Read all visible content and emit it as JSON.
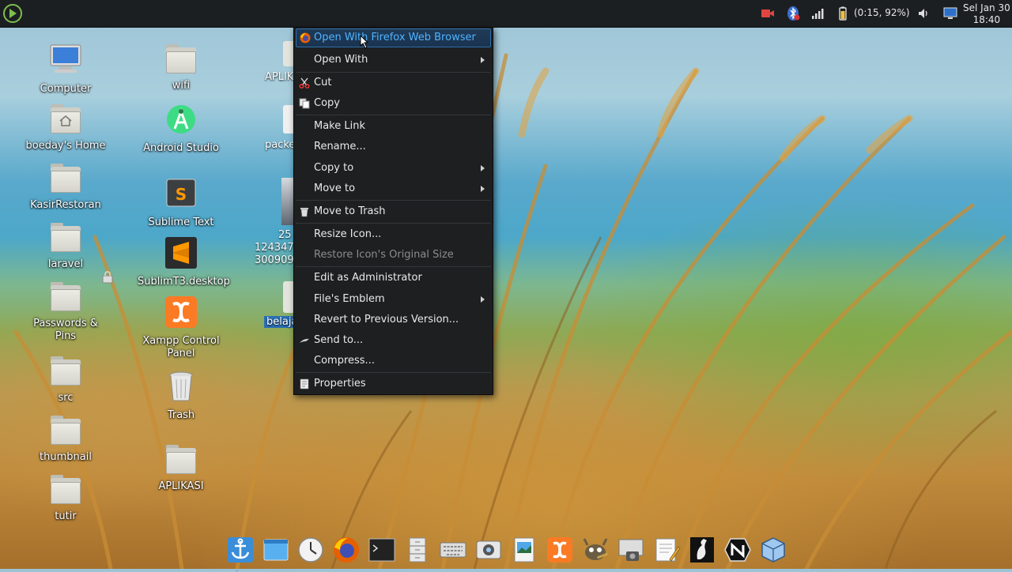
{
  "top_panel": {
    "battery_status": "(0:15, 92%)",
    "clock_line1": "Sel Jan 30",
    "clock_line2": "18:40",
    "icons": [
      "menu-icon",
      "camera-record-icon",
      "bluetooth-icon",
      "signal-icon",
      "battery-charging-icon",
      "volume-icon",
      "display-icon"
    ]
  },
  "desktop": {
    "col1": [
      "Computer",
      "boeday's Home",
      "KasirRestoran",
      "laravel",
      "Passwords & Pins",
      "src",
      "thumbnail",
      "tutir"
    ],
    "col2": [
      "wifi",
      "Android Studio",
      "Sublime Text",
      "SublimT3.desktop",
      "Xampp Control Panel",
      "Trash",
      "APLIKASI"
    ],
    "col3_partial": [
      "APLIK",
      "packe",
      "25",
      "124347",
      "300909",
      "belaja"
    ]
  },
  "context_menu": {
    "items": [
      {
        "label": "Open With Firefox Web Browser",
        "icon": "firefox-icon",
        "highlighted": true
      },
      {
        "label": "Open With",
        "submenu": true
      },
      {
        "label": "Cut",
        "icon": "scissors-icon"
      },
      {
        "label": "Copy",
        "icon": "copy-icon"
      },
      {
        "label": "Make Link"
      },
      {
        "label": "Rename..."
      },
      {
        "label": "Copy to",
        "submenu": true
      },
      {
        "label": "Move to",
        "submenu": true
      },
      {
        "label": "Move to Trash",
        "icon": "trash-icon"
      },
      {
        "label": "Resize Icon..."
      },
      {
        "label": "Restore Icon's Original Size",
        "disabled": true
      },
      {
        "label": "Edit as Administrator"
      },
      {
        "label": "File's Emblem",
        "submenu": true
      },
      {
        "label": "Revert to Previous Version..."
      },
      {
        "label": "Send to...",
        "icon": "send-icon"
      },
      {
        "label": "Compress..."
      },
      {
        "label": "Properties",
        "icon": "properties-icon"
      }
    ]
  },
  "dock": {
    "items": [
      "anchor-icon",
      "window-icon",
      "clock-icon",
      "firefox-icon",
      "terminal-icon",
      "file-cabinet-icon",
      "keyboard-icon",
      "webcam-icon",
      "image-viewer-icon",
      "xampp-icon",
      "gimp-icon",
      "screenshot-icon",
      "text-editor-icon",
      "inkscape-icon",
      "nomachine-icon",
      "virtualbox-icon"
    ]
  },
  "colors": {
    "panel": "#1c1f22",
    "menu_bg": "#1d1f20",
    "highlight_text": "#4fb3ff",
    "highlight_border": "#2d6fa9"
  }
}
